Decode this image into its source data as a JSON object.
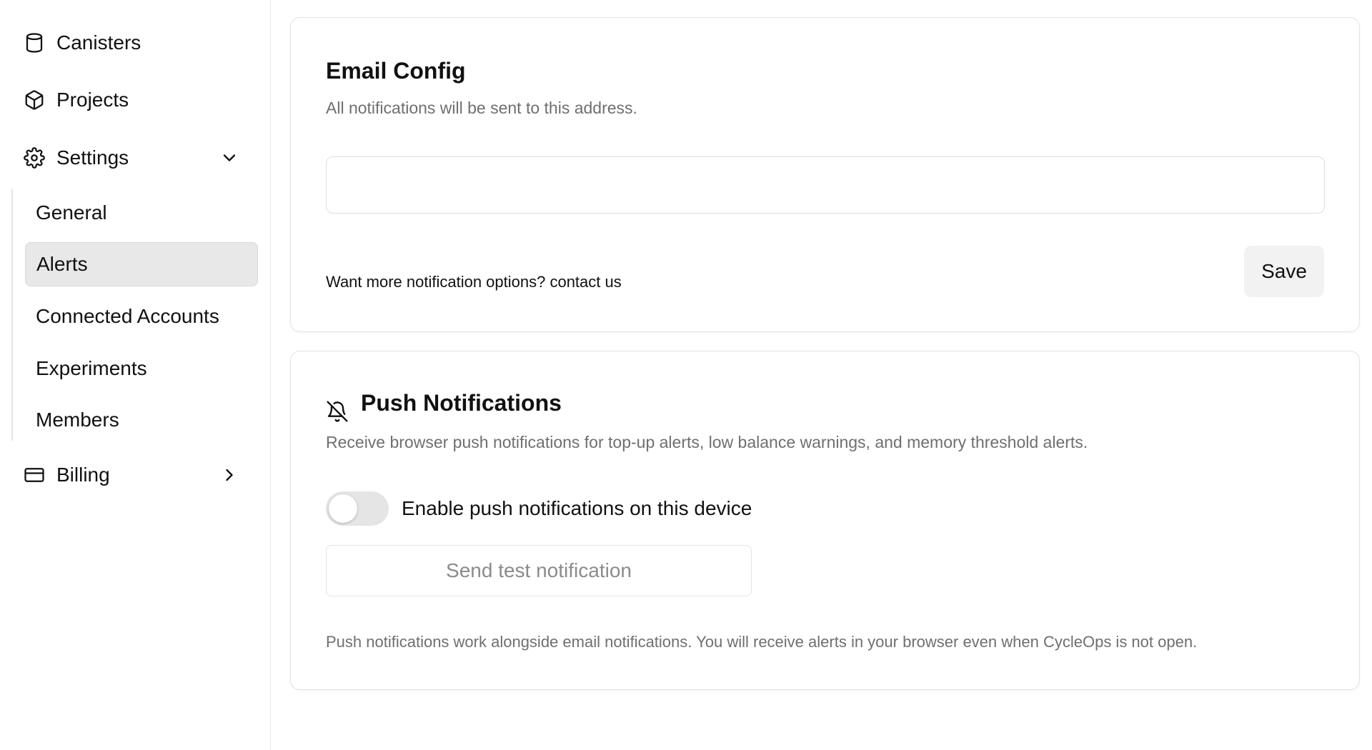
{
  "sidebar": {
    "items": [
      {
        "label": "Canisters",
        "icon": "database-icon"
      },
      {
        "label": "Projects",
        "icon": "box-icon"
      },
      {
        "label": "Settings",
        "icon": "gear-icon",
        "expanded": true
      },
      {
        "label": "Billing",
        "icon": "credit-card-icon",
        "expanded": false
      }
    ],
    "settings_sub": [
      {
        "label": "General"
      },
      {
        "label": "Alerts",
        "active": true
      },
      {
        "label": "Connected Accounts"
      },
      {
        "label": "Experiments"
      },
      {
        "label": "Members"
      }
    ]
  },
  "email_config": {
    "title": "Email Config",
    "description": "All notifications will be sent to this address.",
    "input_value": "",
    "contact_text": "Want more notification options? contact us",
    "save_label": "Save"
  },
  "push": {
    "title": "Push Notifications",
    "description": "Receive browser push notifications for top-up alerts, low balance warnings, and memory threshold alerts.",
    "toggle_label": "Enable push notifications on this device",
    "toggle_on": false,
    "test_label": "Send test notification",
    "footer": "Push notifications work alongside email notifications. You will receive alerts in your browser even when CycleOps is not open."
  },
  "colors": {
    "active_bg": "#e8e8e8",
    "border": "#e3e3e3",
    "muted_text": "#6f6f6f"
  }
}
